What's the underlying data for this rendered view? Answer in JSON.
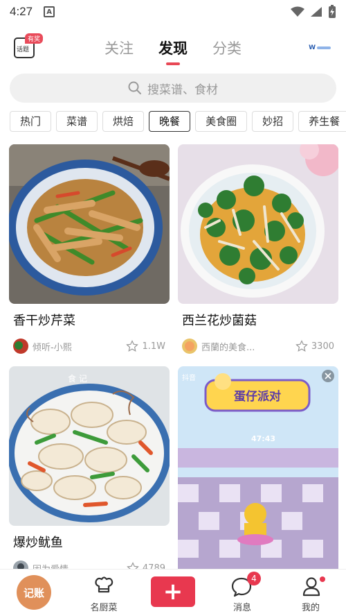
{
  "status_bar": {
    "time": "4:27",
    "app_icon_letter": "A"
  },
  "header": {
    "topic_label": "话题",
    "topic_badge": "有奖",
    "tabs": [
      {
        "label": "关注",
        "active": false
      },
      {
        "label": "发现",
        "active": true
      },
      {
        "label": "分类",
        "active": false
      }
    ],
    "brand": "W"
  },
  "search": {
    "placeholder": "搜菜谱、食材"
  },
  "chips": [
    {
      "label": "热门",
      "active": false
    },
    {
      "label": "菜谱",
      "active": false
    },
    {
      "label": "烘焙",
      "active": false
    },
    {
      "label": "晚餐",
      "active": true
    },
    {
      "label": "美食圈",
      "active": false
    },
    {
      "label": "妙招",
      "active": false
    },
    {
      "label": "养生餐",
      "active": false
    }
  ],
  "feed": {
    "cards": [
      {
        "title": "香干炒芹菜",
        "author": "倾听-小熙",
        "likes": "1.1W"
      },
      {
        "title": "西兰花炒菌菇",
        "author": "西蘭的美食...",
        "likes": "3300"
      },
      {
        "title": "爆炒鱿鱼",
        "author": "因为爱情",
        "likes": "4789",
        "watermark": "食 记"
      },
      {
        "ad_platform": "抖音",
        "ad_title": "蛋仔派对",
        "ad_timer": "47:43"
      }
    ]
  },
  "bottom_nav": {
    "jizhang": "记账",
    "chef": "名厨菜",
    "add": "+",
    "message": "消息",
    "message_count": "4",
    "me": "我的"
  },
  "colors": {
    "accent": "#e8384f",
    "jizhang_bg": "#e0905a"
  }
}
